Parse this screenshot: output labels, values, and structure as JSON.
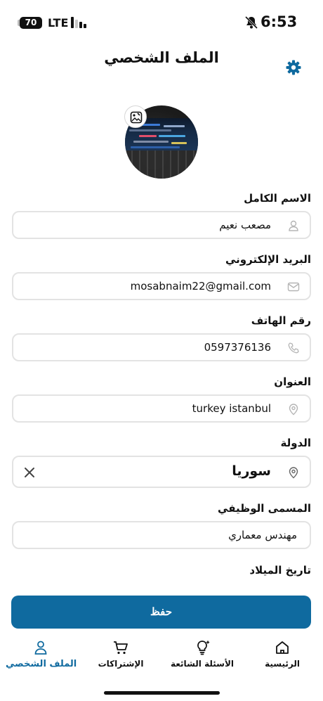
{
  "status_bar": {
    "battery": "70",
    "network": "LTE",
    "time": "6:53"
  },
  "header": {
    "title": "الملف الشخصي",
    "settings_icon": "gear-icon"
  },
  "colors": {
    "accent": "#0f6a9f",
    "field_border": "#e3e3e3"
  },
  "form": {
    "full_name": {
      "label": "الاسم الكامل",
      "value": "مصعب نعيم",
      "icon": "user-icon"
    },
    "email": {
      "label": "البريد الإلكتروني",
      "value": "mosabnaim22@gmail.com",
      "icon": "mail-icon"
    },
    "phone": {
      "label": "رقم الهاتف",
      "value": "0597376136",
      "icon": "phone-icon"
    },
    "address": {
      "label": "العنوان",
      "value": "turkey istanbul",
      "icon": "location-pin-icon"
    },
    "country": {
      "label": "الدولة",
      "value": "سوريا",
      "icon": "location-pin-icon",
      "clear_icon": "close-icon"
    },
    "job_title": {
      "label": "المسمى الوظيفي",
      "value": "مهندس معماري"
    },
    "birth_date": {
      "label": "تاريخ الميلاد"
    }
  },
  "save_button": {
    "label": "حفظ"
  },
  "tab_bar": {
    "home": {
      "label": "الرئيسية",
      "icon": "home-icon"
    },
    "faq": {
      "label": "الأسئلة الشائعة",
      "icon": "lightbulb-icon"
    },
    "subscriptions": {
      "label": "الإشتراكات",
      "icon": "cart-icon"
    },
    "profile": {
      "label": "الملف الشخصي",
      "icon": "user-icon",
      "active": true
    }
  }
}
